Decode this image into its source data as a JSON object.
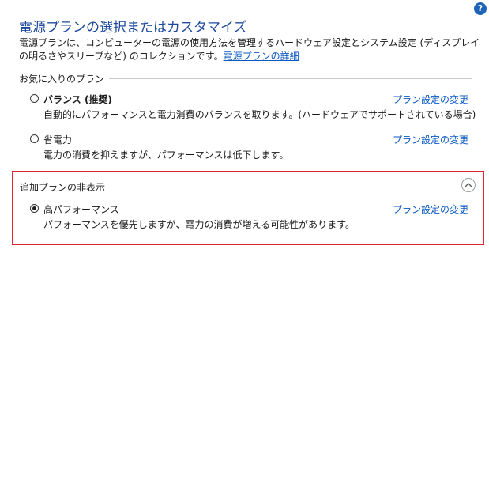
{
  "help": {
    "glyph": "?"
  },
  "title": "電源プランの選択またはカスタマイズ",
  "description": {
    "text": "電源プランは、コンピューターの電源の使用方法を管理するハードウェア設定とシステム設定 (ディスプレイの明るさやスリープなど) のコレクションです。",
    "link": "電源プランの詳細"
  },
  "favorites": {
    "heading": "お気に入りのプラン",
    "plans": [
      {
        "name": "バランス (推奨)",
        "description": "自動的にパフォーマンスと電力消費のバランスを取ります。(ハードウェアでサポートされている場合)",
        "link": "プラン設定の変更",
        "selected": false
      },
      {
        "name": "省電力",
        "description": "電力の消費を抑えますが、パフォーマンスは低下します。",
        "link": "プラン設定の変更",
        "selected": false
      }
    ]
  },
  "hidden": {
    "heading": "追加プランの非表示",
    "collapse_icon": "chevron-up-icon",
    "plans": [
      {
        "name": "高パフォーマンス",
        "description": "パフォーマンスを優先しますが、電力の消費が増える可能性があります。",
        "link": "プラン設定の変更",
        "selected": true
      }
    ]
  },
  "colors": {
    "title": "#1f4a9c",
    "link": "#0a58c2",
    "highlight": "#e0282e"
  }
}
